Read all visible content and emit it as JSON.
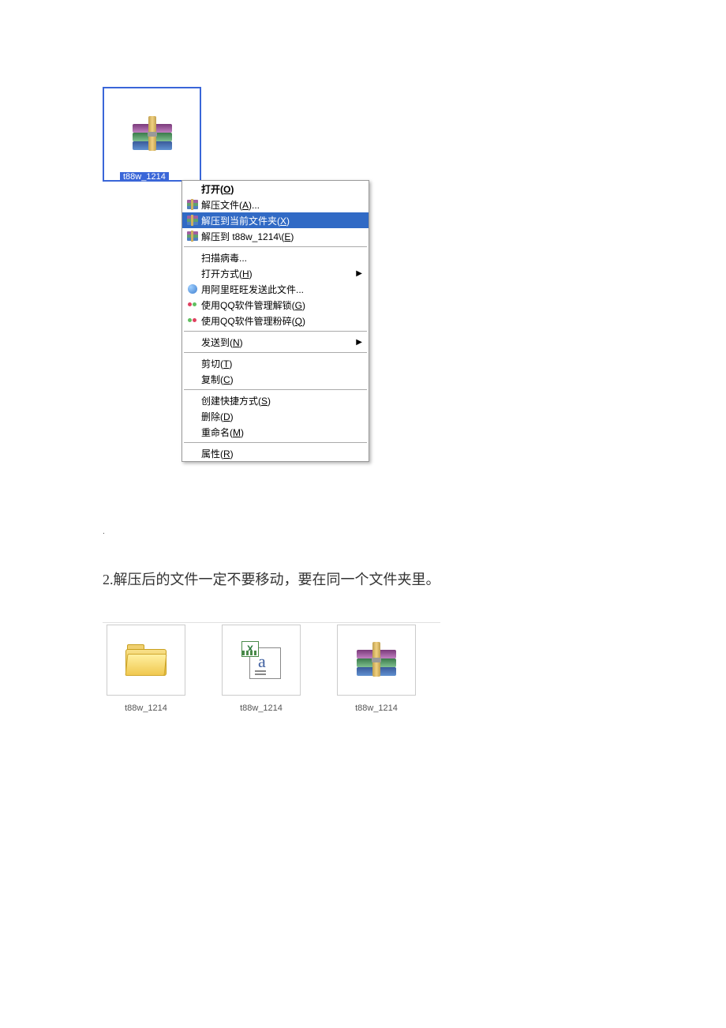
{
  "archive": {
    "filename": "t88w_1214"
  },
  "menu": {
    "open": "打开(O)",
    "extract_files": "解压文件(A)...",
    "extract_here": "解压到当前文件夹(X)",
    "extract_to_folder": "解压到 t88w_1214\\(E)",
    "scan_virus": "扫描病毒...",
    "open_with": "打开方式(H)",
    "aliwang": "用阿里旺旺发送此文件...",
    "qq_unlock": "使用QQ软件管理解锁(G)",
    "qq_shred": "使用QQ软件管理粉碎(Q)",
    "send_to": "发送到(N)",
    "cut": "剪切(T)",
    "copy": "复制(C)",
    "shortcut": "创建快捷方式(S)",
    "delete": "删除(D)",
    "rename": "重命名(M)",
    "properties": "属性(R)"
  },
  "caption": {
    "text": "2.解压后的文件一定不要移动，要在同一个文件夹里。"
  },
  "files": [
    {
      "name": "t88w_1214",
      "type": "folder"
    },
    {
      "name": "t88w_1214",
      "type": "excel"
    },
    {
      "name": "t88w_1214",
      "type": "rar"
    }
  ]
}
